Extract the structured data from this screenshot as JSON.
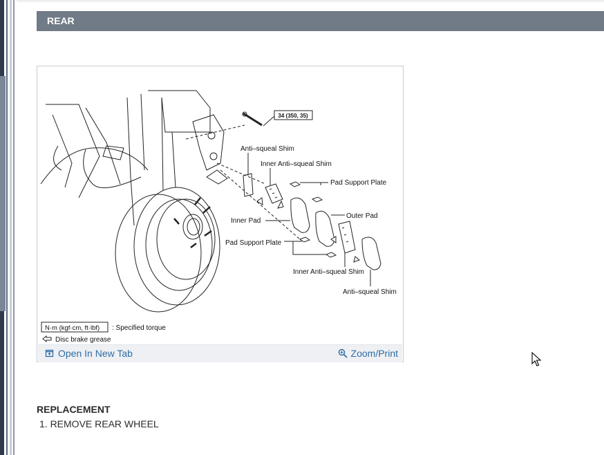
{
  "section": {
    "title": "REAR"
  },
  "figure": {
    "callouts": {
      "torque": "34 (350, 35)",
      "anti_squeal_shim_top": "Anti–squeal Shim",
      "inner_anti_squeal_shim_top": "Inner Anti–squeal Shim",
      "pad_support_plate_top": "Pad Support Plate",
      "outer_pad": "Outer Pad",
      "inner_pad": "Inner Pad",
      "pad_support_plate_bottom": "Pad Support Plate",
      "inner_anti_squeal_shim_bottom": "Inner Anti–squeal Shim",
      "anti_squeal_shim_bottom": "Anti–squeal Shim"
    },
    "legend": {
      "torque_unit": "N·m (kgf·cm, ft·lbf)",
      "torque_desc": ": Specified torque",
      "grease_desc": "Disc brake grease"
    },
    "footer": {
      "open_label": "Open In New Tab",
      "zoom_label": "Zoom/Print",
      "link_color": "#2e6da4"
    }
  },
  "replacement": {
    "title": "REPLACEMENT",
    "steps": [
      "1. REMOVE REAR WHEEL"
    ]
  },
  "colors": {
    "header_bg": "#717b87",
    "footer_bg": "#eef0f4"
  }
}
